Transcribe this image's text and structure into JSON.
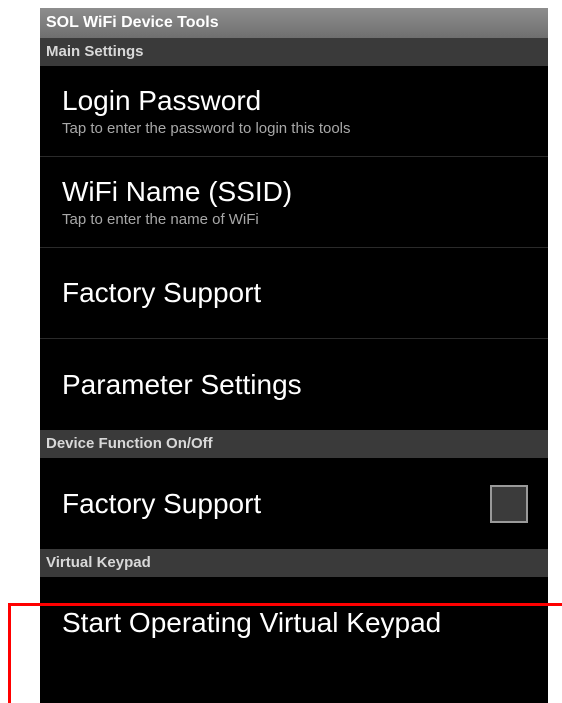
{
  "app": {
    "title": "SOL WiFi Device Tools"
  },
  "sections": [
    {
      "header": "Main Settings",
      "items": [
        {
          "label": "Login Password",
          "summary": "Tap to enter the password to login this tools"
        },
        {
          "label": "WiFi Name (SSID)",
          "summary": "Tap to enter the name of WiFi"
        },
        {
          "label": "Factory Support"
        },
        {
          "label": "Parameter Settings"
        }
      ]
    },
    {
      "header": "Device Function On/Off",
      "items": [
        {
          "label": "Factory Support",
          "checkbox": {
            "checked": false
          }
        }
      ]
    },
    {
      "header": "Virtual Keypad",
      "items": [
        {
          "label": "Start Operating Virtual Keypad"
        }
      ]
    }
  ],
  "colors": {
    "annotation": "#ff0000",
    "background": "#000000",
    "header": "#3a3a3a"
  }
}
